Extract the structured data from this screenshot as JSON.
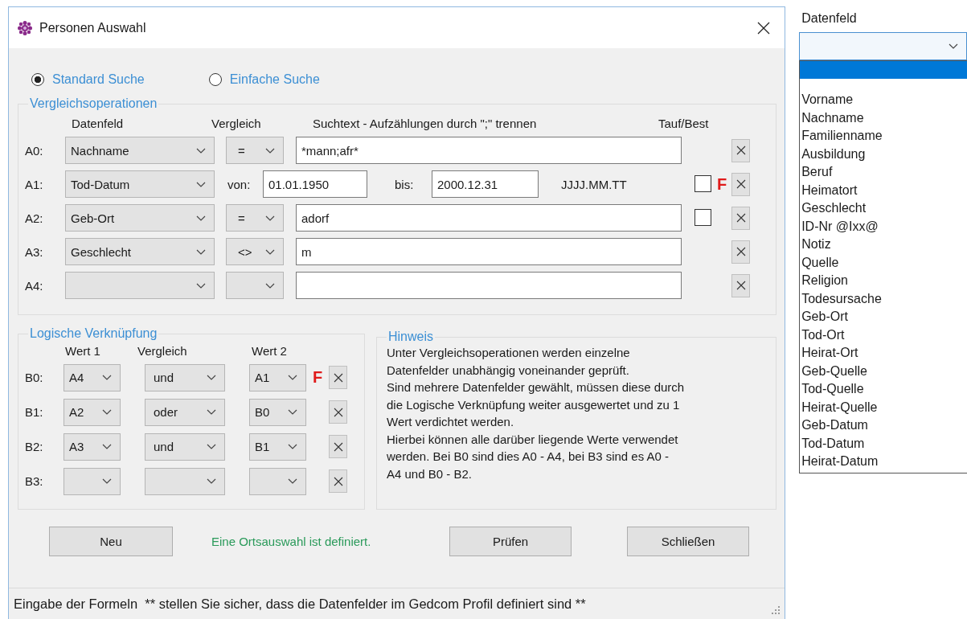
{
  "window": {
    "title": "Personen Auswahl"
  },
  "search_mode": [
    {
      "label": "Standard Suche",
      "selected": true
    },
    {
      "label": "Einfache Suche",
      "selected": false
    }
  ],
  "comparisons": {
    "title": "Vergleichsoperationen",
    "columns": [
      "Datenfeld",
      "Vergleich",
      "Suchtext - Aufzählungen durch \";\" trennen",
      "Tauf/Best"
    ],
    "rows": [
      {
        "kind": "match",
        "label": "A0:",
        "field": "Nachname",
        "operator": "=",
        "text": "*mann;afr*"
      },
      {
        "kind": "range",
        "label": "A1:",
        "field": "Tod-Datum",
        "from_label": "von:",
        "from": "01.01.1950",
        "to_label": "bis:",
        "to": "2000.12.31",
        "format": "JJJJ.MM.TT",
        "tauf_best": {
          "checked": false
        },
        "flag": "F"
      },
      {
        "kind": "match",
        "label": "A2:",
        "field": "Geb-Ort",
        "operator": "=",
        "text": "adorf",
        "tauf_best": {
          "checked": false
        }
      },
      {
        "kind": "match",
        "label": "A3:",
        "field": "Geschlecht",
        "operator": "<>",
        "text": "m"
      },
      {
        "kind": "match",
        "label": "A4:"
      }
    ]
  },
  "logic": {
    "title": "Logische Verknüpfung",
    "columns": [
      "Wert 1",
      "Vergleich",
      "Wert 2"
    ],
    "rows": [
      {
        "label": "B0:",
        "value1": "A4",
        "operator": "und",
        "value2": "A1",
        "flag": "F"
      },
      {
        "label": "B1:",
        "value1": "A2",
        "operator": "oder",
        "value2": "B0"
      },
      {
        "label": "B2:",
        "value1": "A3",
        "operator": "und",
        "value2": "B1"
      },
      {
        "label": "B3:"
      }
    ]
  },
  "hint": {
    "title": "Hinweis",
    "text": "Unter Vergleichsoperationen werden einzelne\nDatenfelder unabhängig voneinander geprüft.\nSind mehrere Datenfelder gewählt, müssen diese durch\ndie Logische Verknüpfung weiter ausgewertet und zu 1\nWert verdichtet werden.\nHierbei können alle darüber liegende Werte verwendet\nwerden. Bei B0 sind dies A0 - A4, bei B3 sind es A0 -\nA4 und B0 - B2."
  },
  "actions": {
    "new": "Neu",
    "message": "Eine Ortsauswahl ist definiert.",
    "check": "Prüfen",
    "close": "Schließen"
  },
  "status_bar": "Eingabe der Formeln  ** stellen Sie sicher, dass die Datenfelder im Gedcom Profil definiert sind **",
  "field_dropdown": {
    "header": "Datenfeld",
    "blank_highlighted": true,
    "options": [
      "Vorname",
      "Nachname",
      "Familienname",
      "Ausbildung",
      "Beruf",
      "Heimatort",
      "Geschlecht",
      "ID-Nr @Ixx@",
      "Notiz",
      "Quelle",
      "Religion",
      "Todesursache",
      "Geb-Ort",
      "Tod-Ort",
      "Heirat-Ort",
      "Geb-Quelle",
      "Tod-Quelle",
      "Heirat-Quelle",
      "Geb-Datum",
      "Tod-Datum",
      "Heirat-Datum"
    ]
  }
}
